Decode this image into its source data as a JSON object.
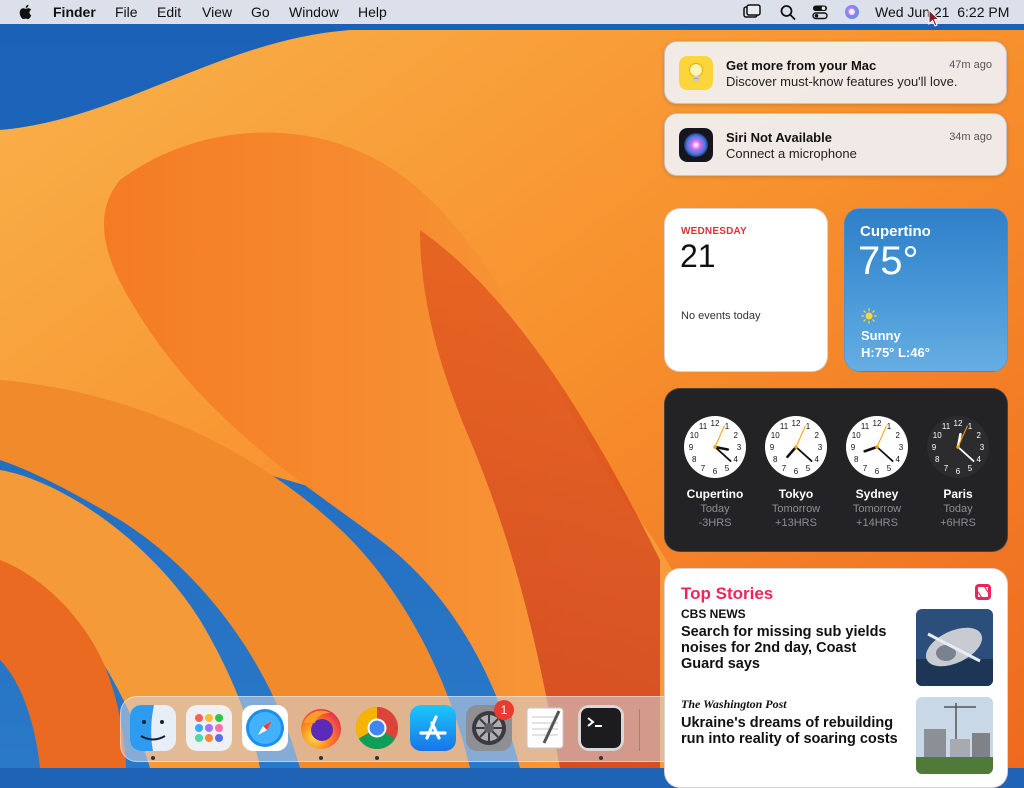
{
  "menubar": {
    "app_name": "Finder",
    "menus": [
      "File",
      "Edit",
      "View",
      "Go",
      "Window",
      "Help"
    ],
    "status_icons": [
      "screen-mirroring-icon",
      "spotlight-search-icon",
      "control-center-icon",
      "siri-icon"
    ],
    "datetime": "Wed Jun 21  6:22 PM"
  },
  "notifications": [
    {
      "app_icon": "tips-lightbulb-icon",
      "title": "Get more from your Mac",
      "body": "Discover must-know features you'll love.",
      "time": "47m ago"
    },
    {
      "app_icon": "siri-icon",
      "title": "Siri Not Available",
      "body": "Connect a microphone",
      "time": "34m ago"
    }
  ],
  "calendar_widget": {
    "weekday": "WEDNESDAY",
    "day": "21",
    "events_text": "No events today"
  },
  "weather_widget": {
    "city": "Cupertino",
    "temperature": "75°",
    "condition": "Sunny",
    "high_low": "H:75° L:46°",
    "icon": "sun-icon"
  },
  "world_clock_widget": {
    "clocks": [
      {
        "city": "Cupertino",
        "day": "Today",
        "offset": "-3HRS",
        "hour": 3,
        "minute": 22,
        "second": 4,
        "face": "light"
      },
      {
        "city": "Tokyo",
        "day": "Tomorrow",
        "offset": "+13HRS",
        "hour": 7,
        "minute": 22,
        "second": 4,
        "face": "light"
      },
      {
        "city": "Sydney",
        "day": "Tomorrow",
        "offset": "+14HRS",
        "hour": 8,
        "minute": 22,
        "second": 4,
        "face": "light"
      },
      {
        "city": "Paris",
        "day": "Today",
        "offset": "+6HRS",
        "hour": 0,
        "minute": 22,
        "second": 4,
        "face": "dark"
      }
    ]
  },
  "news_widget": {
    "header": "Top Stories",
    "stories": [
      {
        "source": "CBS NEWS",
        "headline": "Search for missing sub yields noises for 2nd day, Coast Guard says"
      },
      {
        "source": "The Washington Post",
        "headline": "Ukraine's dreams of rebuilding run into reality of soaring costs"
      }
    ]
  },
  "dock": {
    "apps": [
      "finder-icon",
      "launchpad-icon",
      "safari-icon",
      "firefox-icon",
      "chrome-icon",
      "app-store-icon",
      "system-settings-icon",
      "textedit-icon",
      "terminal-icon"
    ],
    "settings_badge": "1"
  },
  "colors": {
    "accent_red": "#e0303a",
    "news_pink": "#f0245a",
    "weather_blue": "#2e7fc9",
    "badge_red": "#ea3b30"
  }
}
